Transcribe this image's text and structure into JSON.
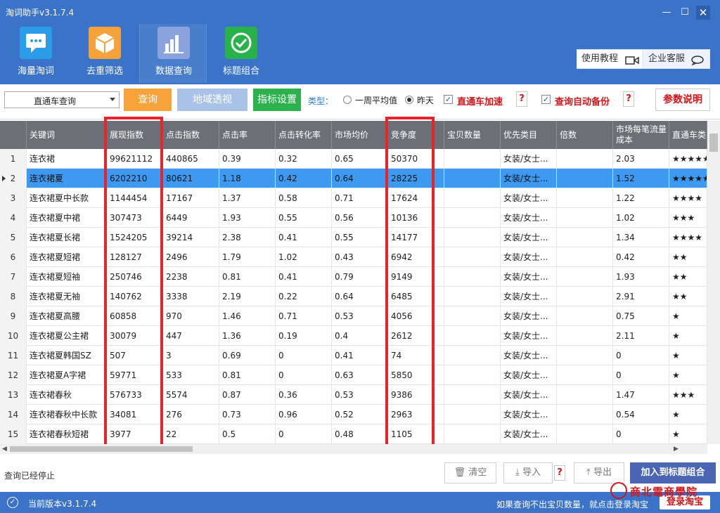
{
  "window": {
    "title": "淘词助手v3.1.7.4",
    "minimize": "—",
    "maximize": "☐",
    "close": "✕"
  },
  "nav": [
    {
      "label": "海量淘词",
      "icon": "chat-bubble-icon",
      "color": "#2b9de8"
    },
    {
      "label": "去重筛选",
      "icon": "cube-icon",
      "color": "#f6a23a"
    },
    {
      "label": "数据查询",
      "icon": "bar-chart-icon",
      "color": "#8ba3dd"
    },
    {
      "label": "标题组合",
      "icon": "check-circle-icon",
      "color": "#27b24a"
    }
  ],
  "help": {
    "tutorial": "使用教程",
    "service": "企业客服"
  },
  "filter": {
    "mode": "直通车查询",
    "query_button": "查询",
    "geo_button": "地域透视",
    "metric_button": "指标设置",
    "type_label": "类型：",
    "radio_week": "一周平均值",
    "radio_yesterday": "昨天",
    "check_accel": "直通车加速",
    "check_backup": "查询自动备份",
    "help_mark": "?",
    "param_button": "参数说明"
  },
  "table": {
    "headers": [
      "关键词",
      "展现指数",
      "点击指数",
      "点击率",
      "点击转化率",
      "市场均价",
      "竞争度",
      "宝贝数量",
      "优先类目",
      "倍数",
      "市场每笔流量成本",
      "直通车类"
    ],
    "rows": [
      {
        "n": "1",
        "kw": "连衣裙",
        "impr": "99621112",
        "click": "440865",
        "ctr": "0.39",
        "cvr": "0.32",
        "price": "0.65",
        "comp": "50370",
        "items": "",
        "cat": "女装/女士...",
        "mult": "",
        "cost": "2.03",
        "stars": "★★★★★"
      },
      {
        "n": "2",
        "kw": "连衣裙夏",
        "impr": "6202210",
        "click": "80621",
        "ctr": "1.18",
        "cvr": "0.42",
        "price": "0.64",
        "comp": "28225",
        "items": "",
        "cat": "女装/女士...",
        "mult": "",
        "cost": "1.52",
        "stars": "★★★★★"
      },
      {
        "n": "3",
        "kw": "连衣裙夏中长款",
        "impr": "1144454",
        "click": "17167",
        "ctr": "1.37",
        "cvr": "0.58",
        "price": "0.71",
        "comp": "17624",
        "items": "",
        "cat": "女装/女士...",
        "mult": "",
        "cost": "1.22",
        "stars": "★★★★"
      },
      {
        "n": "4",
        "kw": "连衣裙夏中裙",
        "impr": "307473",
        "click": "6449",
        "ctr": "1.93",
        "cvr": "0.55",
        "price": "0.56",
        "comp": "10136",
        "items": "",
        "cat": "女装/女士...",
        "mult": "",
        "cost": "1.02",
        "stars": "★★★"
      },
      {
        "n": "5",
        "kw": "连衣裙夏长裙",
        "impr": "1524205",
        "click": "39214",
        "ctr": "2.38",
        "cvr": "0.41",
        "price": "0.55",
        "comp": "14177",
        "items": "",
        "cat": "女装/女士...",
        "mult": "",
        "cost": "1.34",
        "stars": "★★★★"
      },
      {
        "n": "6",
        "kw": "连衣裙夏短裙",
        "impr": "128127",
        "click": "2496",
        "ctr": "1.79",
        "cvr": "1.02",
        "price": "0.43",
        "comp": "6942",
        "items": "",
        "cat": "女装/女士...",
        "mult": "",
        "cost": "0.42",
        "stars": "★★"
      },
      {
        "n": "7",
        "kw": "连衣裙夏短袖",
        "impr": "250746",
        "click": "2238",
        "ctr": "0.81",
        "cvr": "0.41",
        "price": "0.79",
        "comp": "9149",
        "items": "",
        "cat": "女装/女士...",
        "mult": "",
        "cost": "1.93",
        "stars": "★★"
      },
      {
        "n": "8",
        "kw": "连衣裙夏无袖",
        "impr": "140762",
        "click": "3338",
        "ctr": "2.19",
        "cvr": "0.22",
        "price": "0.64",
        "comp": "6485",
        "items": "",
        "cat": "女装/女士...",
        "mult": "",
        "cost": "2.91",
        "stars": "★★"
      },
      {
        "n": "9",
        "kw": "连衣裙夏高腰",
        "impr": "60858",
        "click": "970",
        "ctr": "1.46",
        "cvr": "0.71",
        "price": "0.53",
        "comp": "4056",
        "items": "",
        "cat": "女装/女士...",
        "mult": "",
        "cost": "0.75",
        "stars": "★"
      },
      {
        "n": "10",
        "kw": "连衣裙夏公主裙",
        "impr": "30079",
        "click": "447",
        "ctr": "1.36",
        "cvr": "0.19",
        "price": "0.4",
        "comp": "2612",
        "items": "",
        "cat": "女装/女士...",
        "mult": "",
        "cost": "2.11",
        "stars": "★"
      },
      {
        "n": "11",
        "kw": "连衣裙夏韩国SZ",
        "impr": "507",
        "click": "3",
        "ctr": "0.69",
        "cvr": "0",
        "price": "0.41",
        "comp": "74",
        "items": "",
        "cat": "女装/女士...",
        "mult": "",
        "cost": "0",
        "stars": "★"
      },
      {
        "n": "12",
        "kw": "连衣裙夏A字裙",
        "impr": "59771",
        "click": "533",
        "ctr": "0.81",
        "cvr": "0",
        "price": "0.63",
        "comp": "5850",
        "items": "",
        "cat": "女装/女士...",
        "mult": "",
        "cost": "0",
        "stars": "★"
      },
      {
        "n": "13",
        "kw": "连衣裙春秋",
        "impr": "576733",
        "click": "5574",
        "ctr": "0.87",
        "cvr": "0.36",
        "price": "0.53",
        "comp": "9386",
        "items": "",
        "cat": "女装/女士...",
        "mult": "",
        "cost": "1.47",
        "stars": "★★★"
      },
      {
        "n": "14",
        "kw": "连衣裙春秋中长款",
        "impr": "34081",
        "click": "276",
        "ctr": "0.73",
        "cvr": "0.96",
        "price": "0.52",
        "comp": "2963",
        "items": "",
        "cat": "女装/女士...",
        "mult": "",
        "cost": "0.54",
        "stars": "★"
      },
      {
        "n": "15",
        "kw": "连衣裙春秋短裙",
        "impr": "3977",
        "click": "22",
        "ctr": "0.5",
        "cvr": "0",
        "price": "0.48",
        "comp": "1105",
        "items": "",
        "cat": "女装/女士...",
        "mult": "",
        "cost": "0",
        "stars": "★"
      }
    ],
    "selected_row": 2
  },
  "actions": {
    "status": "查询已经停止",
    "clear": "清空",
    "import": "导入",
    "help_mark": "?",
    "export": "导出",
    "add_to_title": "加入到标题组合"
  },
  "footer": {
    "version": "当前版本v3.1.7.4",
    "tip": "如果查询不出宝贝数量，就点击登录淘宝",
    "login": "登录淘宝",
    "watermark": "商北電商學院"
  },
  "colors": {
    "brand_blue": "#3a73c8",
    "highlight_red": "#e8232a",
    "selected_row": "#3d9af0",
    "header_gray": "#6c7076"
  }
}
